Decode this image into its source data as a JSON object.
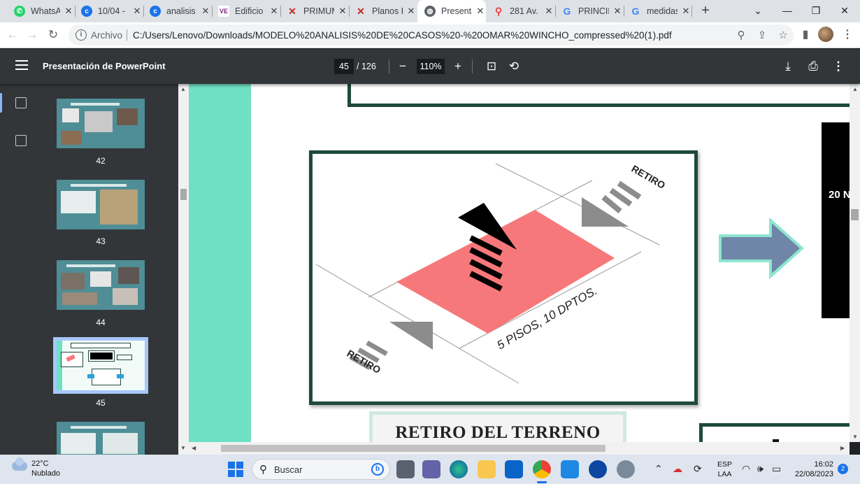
{
  "tabs": [
    {
      "label": "WhatsApp",
      "icon": "whatsapp-icon",
      "color": "#25d366"
    },
    {
      "label": "10/04 - ",
      "icon": "circle-c-icon",
      "color": "#1a73e8"
    },
    {
      "label": "analisis",
      "icon": "circle-c-icon",
      "color": "#1a73e8"
    },
    {
      "label": "Edificio",
      "icon": "ve-logo-icon",
      "color": "#7a2a7a"
    },
    {
      "label": "PRIMUM",
      "icon": "x-logo-icon",
      "color": "#c62828"
    },
    {
      "label": "Planos P",
      "icon": "x-logo-icon",
      "color": "#c62828"
    },
    {
      "label": "Presenta",
      "icon": "globe-icon",
      "color": "#5f6368",
      "active": true
    },
    {
      "label": "281 Av.",
      "icon": "maps-pin-icon",
      "color": "#ea4335"
    },
    {
      "label": "PRINCIP",
      "icon": "google-icon",
      "color": "#4285f4"
    },
    {
      "label": "medidas",
      "icon": "google-icon",
      "color": "#4285f4"
    }
  ],
  "address": {
    "scheme": "Archivo",
    "url": "C:/Users/Lenovo/Downloads/MODELO%20ANALISIS%20DE%20CASOS%20-%20OMAR%20WINCHO_compressed%20(1).pdf"
  },
  "pdf": {
    "title": "Presentación de PowerPoint",
    "page": "45",
    "total": "/ 126",
    "zoom": "110%"
  },
  "thumbnails": [
    {
      "num": "42"
    },
    {
      "num": "43"
    },
    {
      "num": "44"
    },
    {
      "num": "45",
      "selected": true
    },
    {
      "num": "46"
    }
  ],
  "slide": {
    "retiro_top": "RETIRO",
    "retiro_bottom": "RETIRO",
    "building_label": "5 PISOS, 10 DPTOS.",
    "black_panel_text": "20 N",
    "caption": "RETIRO DEL TERRENO"
  },
  "taskbar": {
    "temp": "22°C",
    "condition": "Nublado",
    "search": "Buscar",
    "lang1": "ESP",
    "lang2": "LAA",
    "time": "16:02",
    "date": "22/08/2023",
    "notifications": "2"
  },
  "colors": {
    "teal": "#6fe0c3",
    "frame": "#1e4a3c",
    "plot": "#f7787a",
    "arrow": "#6f86a8"
  }
}
